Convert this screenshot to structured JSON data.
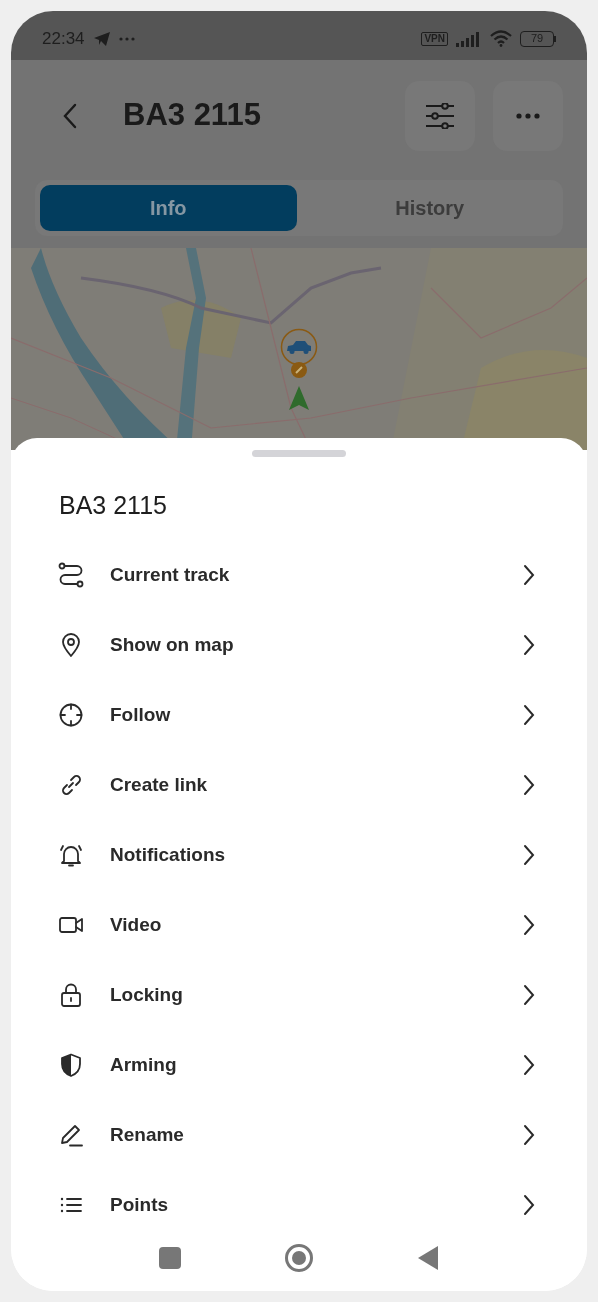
{
  "status_bar": {
    "time": "22:34",
    "vpn": "VPN",
    "battery": "79"
  },
  "header": {
    "title": "BA3 2115"
  },
  "tabs": [
    {
      "label": "Info",
      "selected": true
    },
    {
      "label": "History",
      "selected": false
    }
  ],
  "sheet": {
    "title": "BA3 2115",
    "items": [
      {
        "label": "Current track"
      },
      {
        "label": "Show on map"
      },
      {
        "label": "Follow"
      },
      {
        "label": "Create link"
      },
      {
        "label": "Notifications"
      },
      {
        "label": "Video"
      },
      {
        "label": "Locking"
      },
      {
        "label": "Arming"
      },
      {
        "label": "Rename"
      },
      {
        "label": "Points"
      }
    ]
  }
}
